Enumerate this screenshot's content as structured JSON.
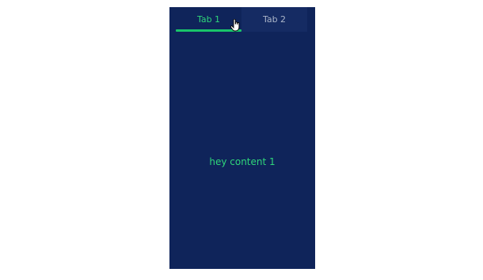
{
  "tabs": [
    {
      "label": "Tab 1",
      "active": true
    },
    {
      "label": "Tab 2",
      "active": false
    }
  ],
  "content": {
    "text": "hey content 1"
  },
  "colors": {
    "panel_bg": "#0f245a",
    "active_text": "#2fd67a",
    "underline": "#19c46a",
    "inactive_text": "#aab4c8"
  },
  "cursor": {
    "icon": "hand-pointer-icon"
  }
}
